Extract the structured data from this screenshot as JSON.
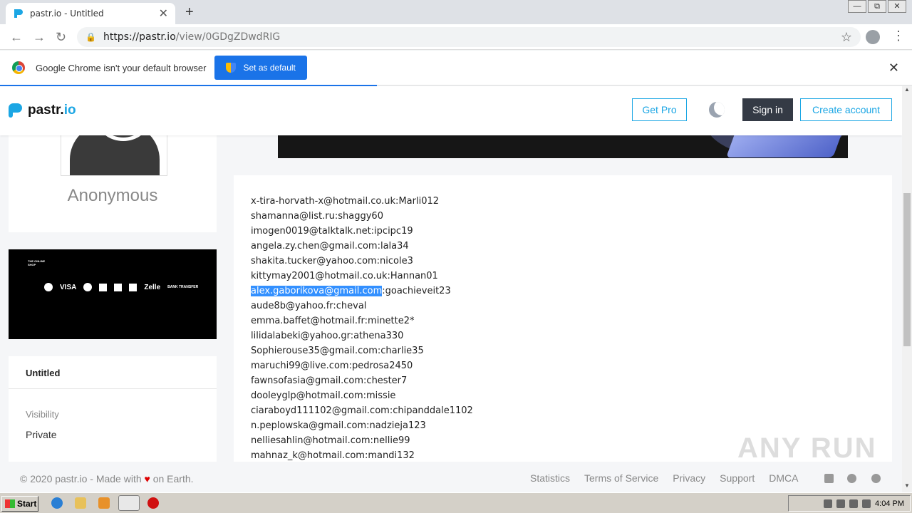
{
  "browser": {
    "tab_title": "pastr.io - Untitled",
    "new_tab": "+",
    "url_host": "https://pastr.io",
    "url_path": "/view/0GDgZDwdRIG",
    "window_controls": [
      "—",
      "⧉",
      "✕"
    ]
  },
  "infobar": {
    "message": "Google Chrome isn't your default browser",
    "button_label": "Set as default"
  },
  "site": {
    "logo_main": "pastr.",
    "logo_accent": "io",
    "get_pro": "Get Pro",
    "sign_in": "Sign in",
    "create_account": "Create account"
  },
  "profile": {
    "name": "Anonymous"
  },
  "ad": {
    "brand": "THE ONLINE SHOP",
    "payments": [
      "VISA",
      "Zelle"
    ],
    "bank_transfer": "BANK TRANSFER"
  },
  "meta": {
    "title": "Untitled",
    "visibility_label": "Visibility",
    "visibility_value": "Private"
  },
  "paste_lines": [
    "x-tira-horvath-x@hotmail.co.uk:Marli012",
    "shamanna@list.ru:shaggy60",
    "imogen0019@talktalk.net:ipcipc19",
    "angela.zy.chen@gmail.com:lala34",
    "shakita.tucker@yahoo.com:nicole3",
    "kittymay2001@hotmail.co.uk:Hannan01",
    "aude8b@yahoo.fr:cheval",
    "emma.baffet@hotmail.fr:minette2*",
    "lilidalabeki@yahoo.gr:athena330",
    "Sophierouse35@gmail.com:charlie35",
    "maruchi99@live.com:pedrosa2450",
    "fawnsofasia@gmail.com:chester7",
    "dooleyglp@hotmail.com:missie",
    "ciaraboyd111102@gmail.com:chipanddale1102",
    "n.peplowska@gmail.com:nadzieja123",
    "nelliesahlin@hotmail.com:nellie99",
    "mahnaz_k@hotmail.com:mandi132"
  ],
  "paste_selected": {
    "selected_part": "alex.gaborikova@gmail.com",
    "rest": ":goachieveit23"
  },
  "footer": {
    "copyright_prefix": "© 2020 pastr.io - Made with",
    "copyright_suffix": "on Earth.",
    "links": [
      "Statistics",
      "Terms of Service",
      "Privacy",
      "Support",
      "DMCA"
    ]
  },
  "watermark": "ANY RUN",
  "taskbar": {
    "start": "Start",
    "clock": "4:04 PM"
  },
  "colors": {
    "accent": "#1ba6e4",
    "selection": "#3390ff",
    "dark_button": "#343a45"
  }
}
